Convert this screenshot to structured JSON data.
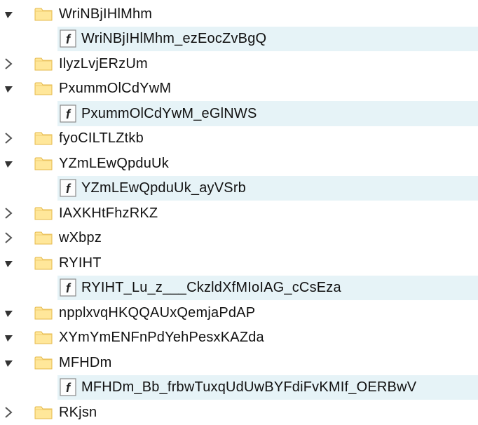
{
  "tree": [
    {
      "type": "folder",
      "expand": "open",
      "label": "WriNBjIHlMhm"
    },
    {
      "type": "file",
      "expand": null,
      "label": "WriNBjIHlMhm_ezEocZvBgQ",
      "highlight": true
    },
    {
      "type": "folder",
      "expand": "closed",
      "label": "IlyzLvjERzUm"
    },
    {
      "type": "folder",
      "expand": "open",
      "label": "PxummOlCdYwM"
    },
    {
      "type": "file",
      "expand": null,
      "label": "PxummOlCdYwM_eGlNWS",
      "highlight": true
    },
    {
      "type": "folder",
      "expand": "closed",
      "label": "fyoCILTLZtkb"
    },
    {
      "type": "folder",
      "expand": "open",
      "label": "YZmLEwQpduUk"
    },
    {
      "type": "file",
      "expand": null,
      "label": "YZmLEwQpduUk_ayVSrb",
      "highlight": true
    },
    {
      "type": "folder",
      "expand": "closed",
      "label": "IAXKHtFhzRKZ"
    },
    {
      "type": "folder",
      "expand": "closed",
      "label": "wXbpz"
    },
    {
      "type": "folder",
      "expand": "open",
      "label": "RYIHT"
    },
    {
      "type": "file",
      "expand": null,
      "label": "RYIHT_Lu_z___CkzldXfMIoIAG_cCsEza",
      "highlight": true
    },
    {
      "type": "folder",
      "expand": "open",
      "label": "npplxvqHKQQAUxQemjaPdAP"
    },
    {
      "type": "folder",
      "expand": "open",
      "label": "XYmYmENFnPdYehPesxKAZda"
    },
    {
      "type": "folder",
      "expand": "open",
      "label": "MFHDm"
    },
    {
      "type": "file",
      "expand": null,
      "label": "MFHDm_Bb_frbwTuxqUdUwBYFdiFvKMIf_OERBwV",
      "highlight": true
    },
    {
      "type": "folder",
      "expand": "closed",
      "label": "RKjsn"
    }
  ]
}
